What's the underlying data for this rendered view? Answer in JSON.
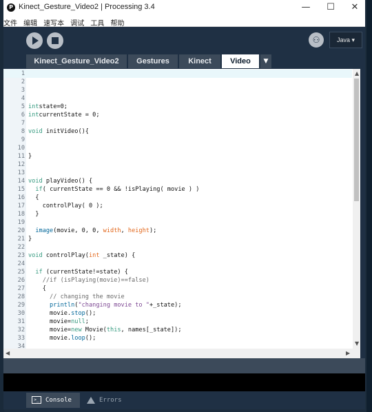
{
  "window": {
    "title": "Kinect_Gesture_Video2 | Processing 3.4",
    "app_icon": "processing-logo"
  },
  "menu": [
    "文件",
    "编辑",
    "速写本",
    "调试",
    "工具",
    "帮助"
  ],
  "window_controls": {
    "minimize": "—",
    "maximize": "☐",
    "close": "✕"
  },
  "toolbar": {
    "mode": "Java ▾",
    "debug_icon": "butterfly-icon"
  },
  "tabs": [
    "Kinect_Gesture_Video2",
    "Gestures",
    "Kinect",
    "Video"
  ],
  "active_tab": "Video",
  "tab_menu": "▼",
  "code_lines": [
    {
      "n": "1",
      "segs": []
    },
    {
      "n": "2",
      "segs": []
    },
    {
      "n": "3",
      "segs": []
    },
    {
      "n": "4",
      "segs": []
    },
    {
      "n": "5",
      "segs": [
        [
          "kw",
          "int"
        ],
        [
          "",
          "state=0;"
        ]
      ]
    },
    {
      "n": "6",
      "segs": [
        [
          "kw",
          "int"
        ],
        [
          "",
          "currentState = 0;"
        ]
      ]
    },
    {
      "n": "7",
      "segs": []
    },
    {
      "n": "8",
      "segs": [
        [
          "kw",
          "void"
        ],
        [
          "",
          " initVideo(){"
        ]
      ]
    },
    {
      "n": "9",
      "segs": []
    },
    {
      "n": "10",
      "segs": []
    },
    {
      "n": "11",
      "segs": [
        [
          "",
          "}"
        ]
      ]
    },
    {
      "n": "12",
      "segs": []
    },
    {
      "n": "13",
      "segs": []
    },
    {
      "n": "14",
      "segs": [
        [
          "kw",
          "void"
        ],
        [
          "",
          " playVideo() {"
        ]
      ]
    },
    {
      "n": "15",
      "segs": [
        [
          "",
          "  "
        ],
        [
          "kw",
          "if"
        ],
        [
          "",
          "( currentState == 0 && !isPlaying( movie ) )"
        ]
      ]
    },
    {
      "n": "16",
      "segs": [
        [
          "",
          "  {"
        ]
      ]
    },
    {
      "n": "17",
      "segs": [
        [
          "",
          "    controlPlay( 0 );"
        ]
      ]
    },
    {
      "n": "18",
      "segs": [
        [
          "",
          "  }"
        ]
      ]
    },
    {
      "n": "19",
      "segs": []
    },
    {
      "n": "20",
      "segs": [
        [
          "",
          "  "
        ],
        [
          "fn",
          "image"
        ],
        [
          "",
          "(movie, 0, 0, "
        ],
        [
          "kw2",
          "width"
        ],
        [
          "",
          ", "
        ],
        [
          "kw2",
          "height"
        ],
        [
          "",
          ");"
        ]
      ]
    },
    {
      "n": "21",
      "segs": [
        [
          "",
          "}"
        ]
      ]
    },
    {
      "n": "22",
      "segs": []
    },
    {
      "n": "23",
      "segs": [
        [
          "kw",
          "void"
        ],
        [
          "",
          " controlPlay("
        ],
        [
          "kw2",
          "int"
        ],
        [
          "",
          " _state) {"
        ]
      ]
    },
    {
      "n": "24",
      "segs": []
    },
    {
      "n": "25",
      "segs": [
        [
          "",
          "  "
        ],
        [
          "kw",
          "if"
        ],
        [
          "",
          " (currentState!=state) {"
        ]
      ]
    },
    {
      "n": "26",
      "segs": [
        [
          "cm",
          "    //if (isPlaying(movie)==false)"
        ]
      ]
    },
    {
      "n": "27",
      "segs": [
        [
          "",
          "    {"
        ]
      ]
    },
    {
      "n": "28",
      "segs": [
        [
          "cm",
          "      // changing the movie"
        ]
      ]
    },
    {
      "n": "29",
      "segs": [
        [
          "",
          "      "
        ],
        [
          "fn",
          "println"
        ],
        [
          "",
          "("
        ],
        [
          "lit",
          "\"changing movie to \""
        ],
        [
          "",
          "+_state);"
        ]
      ]
    },
    {
      "n": "30",
      "segs": [
        [
          "",
          "      movie."
        ],
        [
          "fn",
          "stop"
        ],
        [
          "",
          "();"
        ]
      ]
    },
    {
      "n": "31",
      "segs": [
        [
          "",
          "      movie="
        ],
        [
          "kw",
          "null"
        ],
        [
          "",
          ";"
        ]
      ]
    },
    {
      "n": "32",
      "segs": [
        [
          "",
          "      movie="
        ],
        [
          "kw",
          "new"
        ],
        [
          "",
          " Movie("
        ],
        [
          "kw",
          "this"
        ],
        [
          "",
          ", names[_state]);"
        ]
      ]
    },
    {
      "n": "33",
      "segs": [
        [
          "",
          "      movie."
        ],
        [
          "fn",
          "loop"
        ],
        [
          "",
          "();"
        ]
      ]
    },
    {
      "n": "34",
      "segs": []
    }
  ],
  "console_tabs": [
    {
      "label": "Console",
      "icon": "console-icon"
    },
    {
      "label": "Errors",
      "icon": "warning-icon"
    }
  ],
  "colors": {
    "keyword": "#33997e",
    "function": "#006699",
    "literal": "#7d4793",
    "comment": "#6a6a6a",
    "builtin": "#e2661a",
    "accent": "#1f3044"
  }
}
